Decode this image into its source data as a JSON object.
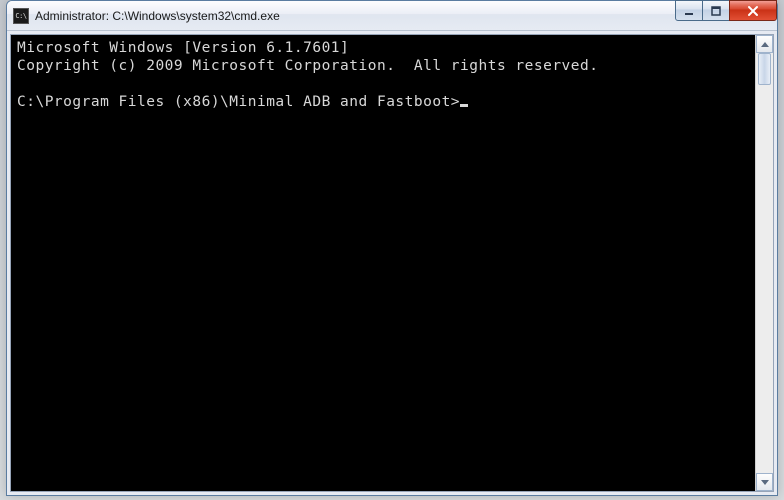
{
  "window": {
    "title": "Administrator: C:\\Windows\\system32\\cmd.exe",
    "icon_label": "C:\\"
  },
  "terminal": {
    "line1": "Microsoft Windows [Version 6.1.7601]",
    "line2": "Copyright (c) 2009 Microsoft Corporation.  All rights reserved.",
    "blank": "",
    "prompt": "C:\\Program Files (x86)\\Minimal ADB and Fastboot>"
  }
}
